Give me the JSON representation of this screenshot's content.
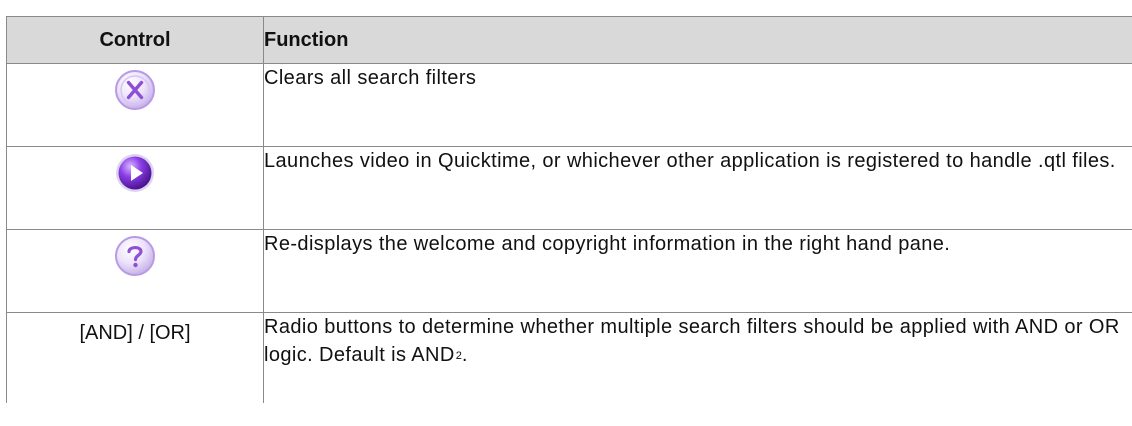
{
  "table": {
    "headers": {
      "control": "Control",
      "function": "Function"
    },
    "rows": [
      {
        "control_icon": "clear-filters-icon",
        "function": "Clears all search filters"
      },
      {
        "control_icon": "play-video-icon",
        "function": "Launches video in Quicktime, or whichever other application is registered to handle .qtl files."
      },
      {
        "control_icon": "help-icon",
        "function": "Re-displays the welcome and copyright information in the right hand pane."
      },
      {
        "control_text": "[AND] / [OR]",
        "function": "Radio buttons to determine whether multiple search filters should be applied with AND or OR logic. Default is AND",
        "footnote": "2",
        "trailing": "."
      }
    ]
  },
  "colors": {
    "header_bg": "#d9d9d9",
    "border": "#8a8a8a",
    "icon_purple": "#7a2fd0",
    "icon_lilac": "#b28ee0"
  }
}
